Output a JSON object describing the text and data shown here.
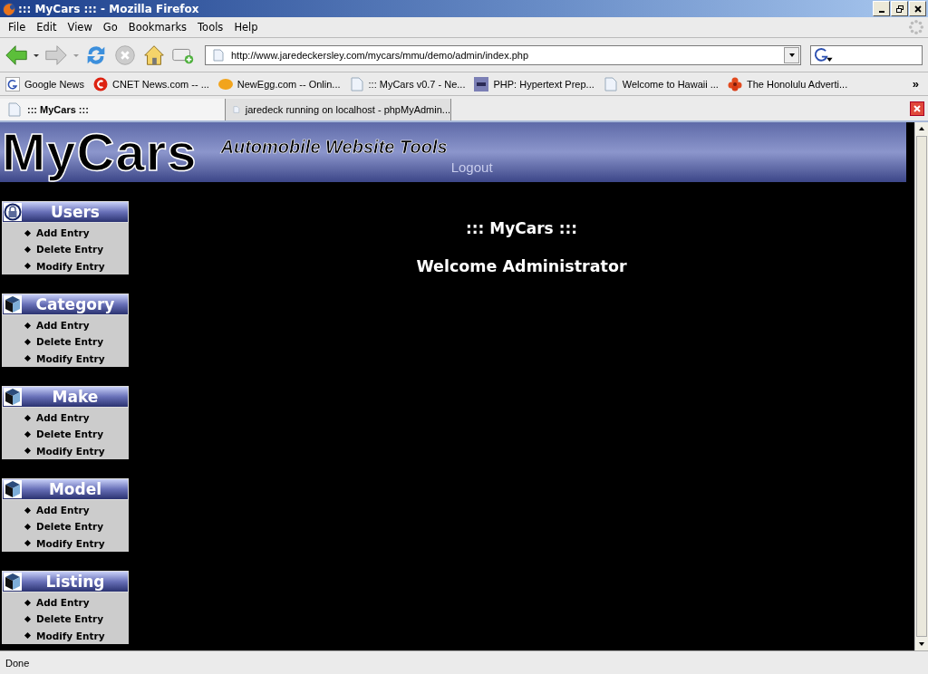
{
  "window": {
    "title": "::: MyCars ::: - Mozilla Firefox"
  },
  "menu": [
    "File",
    "Edit",
    "View",
    "Go",
    "Bookmarks",
    "Tools",
    "Help"
  ],
  "address": {
    "value": "http://www.jaredeckersley.com/mycars/mmu/demo/admin/index.php"
  },
  "bookmarks": [
    {
      "label": "Google News",
      "kind": "google"
    },
    {
      "label": "CNET News.com -- ...",
      "kind": "cnet"
    },
    {
      "label": "NewEgg.com -- Onlin...",
      "kind": "egg"
    },
    {
      "label": "::: MyCars v0.7 - Ne...",
      "kind": "page"
    },
    {
      "label": "PHP: Hypertext Prep...",
      "kind": "php"
    },
    {
      "label": "Welcome to Hawaii ...",
      "kind": "page"
    },
    {
      "label": "The Honolulu Adverti...",
      "kind": "flower"
    }
  ],
  "bookmarks_more": "»",
  "tabs": [
    {
      "label": "::: MyCars :::",
      "selected": true
    },
    {
      "label": "jaredeck running on localhost - phpMyAdmin...",
      "selected": false
    }
  ],
  "banner": {
    "logo": "MyCars",
    "tagline": "Automobile Website Tools",
    "logout": "Logout"
  },
  "sections": [
    {
      "title": "Users",
      "kind": "lock",
      "items": [
        "Add Entry",
        "Delete Entry",
        "Modify Entry"
      ]
    },
    {
      "title": "Category",
      "kind": "cube",
      "items": [
        "Add Entry",
        "Delete Entry",
        "Modify Entry"
      ]
    },
    {
      "title": "Make",
      "kind": "cube",
      "items": [
        "Add Entry",
        "Delete Entry",
        "Modify Entry"
      ]
    },
    {
      "title": "Model",
      "kind": "cube",
      "items": [
        "Add Entry",
        "Delete Entry",
        "Modify Entry"
      ]
    },
    {
      "title": "Listing",
      "kind": "cube",
      "items": [
        "Add Entry",
        "Delete Entry",
        "Modify Entry"
      ]
    }
  ],
  "main": {
    "heading": "::: MyCars :::",
    "welcome": "Welcome Administrator"
  },
  "status_bar": "Done"
}
